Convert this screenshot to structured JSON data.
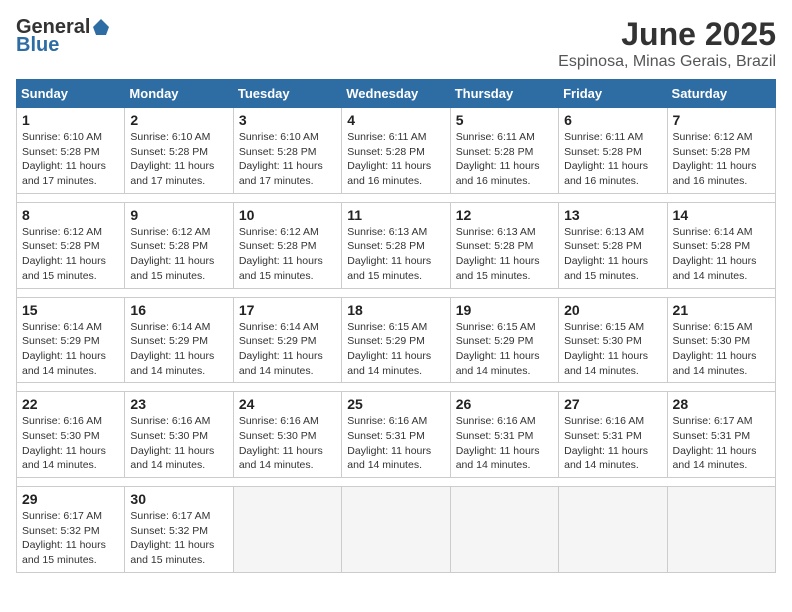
{
  "logo": {
    "general": "General",
    "blue": "Blue"
  },
  "title": "June 2025",
  "subtitle": "Espinosa, Minas Gerais, Brazil",
  "days_header": [
    "Sunday",
    "Monday",
    "Tuesday",
    "Wednesday",
    "Thursday",
    "Friday",
    "Saturday"
  ],
  "weeks": [
    [
      {
        "day": "1",
        "info": "Sunrise: 6:10 AM\nSunset: 5:28 PM\nDaylight: 11 hours\nand 17 minutes."
      },
      {
        "day": "2",
        "info": "Sunrise: 6:10 AM\nSunset: 5:28 PM\nDaylight: 11 hours\nand 17 minutes."
      },
      {
        "day": "3",
        "info": "Sunrise: 6:10 AM\nSunset: 5:28 PM\nDaylight: 11 hours\nand 17 minutes."
      },
      {
        "day": "4",
        "info": "Sunrise: 6:11 AM\nSunset: 5:28 PM\nDaylight: 11 hours\nand 16 minutes."
      },
      {
        "day": "5",
        "info": "Sunrise: 6:11 AM\nSunset: 5:28 PM\nDaylight: 11 hours\nand 16 minutes."
      },
      {
        "day": "6",
        "info": "Sunrise: 6:11 AM\nSunset: 5:28 PM\nDaylight: 11 hours\nand 16 minutes."
      },
      {
        "day": "7",
        "info": "Sunrise: 6:12 AM\nSunset: 5:28 PM\nDaylight: 11 hours\nand 16 minutes."
      }
    ],
    [
      {
        "day": "8",
        "info": "Sunrise: 6:12 AM\nSunset: 5:28 PM\nDaylight: 11 hours\nand 15 minutes."
      },
      {
        "day": "9",
        "info": "Sunrise: 6:12 AM\nSunset: 5:28 PM\nDaylight: 11 hours\nand 15 minutes."
      },
      {
        "day": "10",
        "info": "Sunrise: 6:12 AM\nSunset: 5:28 PM\nDaylight: 11 hours\nand 15 minutes."
      },
      {
        "day": "11",
        "info": "Sunrise: 6:13 AM\nSunset: 5:28 PM\nDaylight: 11 hours\nand 15 minutes."
      },
      {
        "day": "12",
        "info": "Sunrise: 6:13 AM\nSunset: 5:28 PM\nDaylight: 11 hours\nand 15 minutes."
      },
      {
        "day": "13",
        "info": "Sunrise: 6:13 AM\nSunset: 5:28 PM\nDaylight: 11 hours\nand 15 minutes."
      },
      {
        "day": "14",
        "info": "Sunrise: 6:14 AM\nSunset: 5:28 PM\nDaylight: 11 hours\nand 14 minutes."
      }
    ],
    [
      {
        "day": "15",
        "info": "Sunrise: 6:14 AM\nSunset: 5:29 PM\nDaylight: 11 hours\nand 14 minutes."
      },
      {
        "day": "16",
        "info": "Sunrise: 6:14 AM\nSunset: 5:29 PM\nDaylight: 11 hours\nand 14 minutes."
      },
      {
        "day": "17",
        "info": "Sunrise: 6:14 AM\nSunset: 5:29 PM\nDaylight: 11 hours\nand 14 minutes."
      },
      {
        "day": "18",
        "info": "Sunrise: 6:15 AM\nSunset: 5:29 PM\nDaylight: 11 hours\nand 14 minutes."
      },
      {
        "day": "19",
        "info": "Sunrise: 6:15 AM\nSunset: 5:29 PM\nDaylight: 11 hours\nand 14 minutes."
      },
      {
        "day": "20",
        "info": "Sunrise: 6:15 AM\nSunset: 5:30 PM\nDaylight: 11 hours\nand 14 minutes."
      },
      {
        "day": "21",
        "info": "Sunrise: 6:15 AM\nSunset: 5:30 PM\nDaylight: 11 hours\nand 14 minutes."
      }
    ],
    [
      {
        "day": "22",
        "info": "Sunrise: 6:16 AM\nSunset: 5:30 PM\nDaylight: 11 hours\nand 14 minutes."
      },
      {
        "day": "23",
        "info": "Sunrise: 6:16 AM\nSunset: 5:30 PM\nDaylight: 11 hours\nand 14 minutes."
      },
      {
        "day": "24",
        "info": "Sunrise: 6:16 AM\nSunset: 5:30 PM\nDaylight: 11 hours\nand 14 minutes."
      },
      {
        "day": "25",
        "info": "Sunrise: 6:16 AM\nSunset: 5:31 PM\nDaylight: 11 hours\nand 14 minutes."
      },
      {
        "day": "26",
        "info": "Sunrise: 6:16 AM\nSunset: 5:31 PM\nDaylight: 11 hours\nand 14 minutes."
      },
      {
        "day": "27",
        "info": "Sunrise: 6:16 AM\nSunset: 5:31 PM\nDaylight: 11 hours\nand 14 minutes."
      },
      {
        "day": "28",
        "info": "Sunrise: 6:17 AM\nSunset: 5:31 PM\nDaylight: 11 hours\nand 14 minutes."
      }
    ],
    [
      {
        "day": "29",
        "info": "Sunrise: 6:17 AM\nSunset: 5:32 PM\nDaylight: 11 hours\nand 15 minutes."
      },
      {
        "day": "30",
        "info": "Sunrise: 6:17 AM\nSunset: 5:32 PM\nDaylight: 11 hours\nand 15 minutes."
      },
      {
        "day": "",
        "info": ""
      },
      {
        "day": "",
        "info": ""
      },
      {
        "day": "",
        "info": ""
      },
      {
        "day": "",
        "info": ""
      },
      {
        "day": "",
        "info": ""
      }
    ]
  ]
}
